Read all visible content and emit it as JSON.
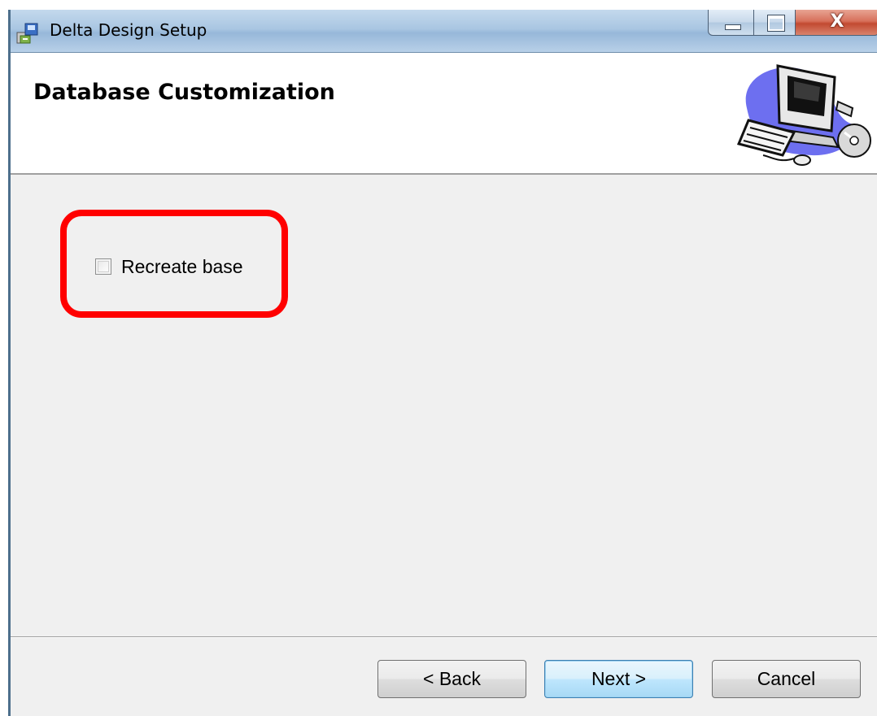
{
  "window": {
    "title": "Delta Design Setup",
    "controls": {
      "minimize_icon": "minimize-icon",
      "maximize_icon": "maximize-icon",
      "close_glyph": "X"
    }
  },
  "banner": {
    "title": "Database Customization",
    "art_icon": "computer-clipart-icon"
  },
  "options": {
    "recreate_base": {
      "label": "Recreate base",
      "checked": false
    }
  },
  "highlight": {
    "color": "#ff0000"
  },
  "buttons": {
    "back": "< Back",
    "next": "Next >",
    "cancel": "Cancel"
  },
  "colors": {
    "titlebar": "#a9c6e2",
    "dialog_bg": "#f0f0f0",
    "banner_bg": "#ffffff",
    "close_button": "#c24a31",
    "default_button_border": "#3c7fb1"
  }
}
